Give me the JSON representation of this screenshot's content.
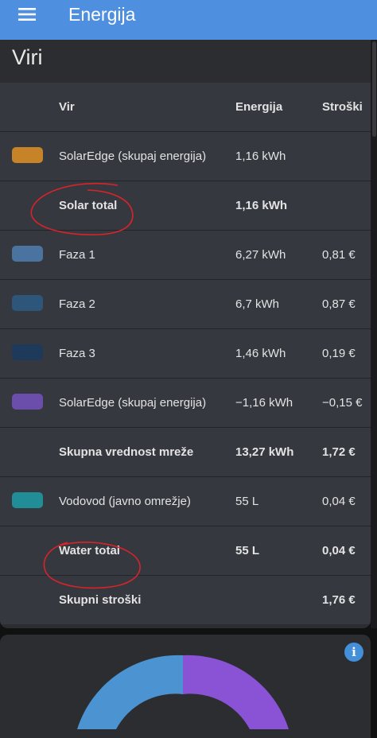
{
  "appbar": {
    "title": "Energija",
    "menu_icon": "menu-icon"
  },
  "card": {
    "title": "Viri",
    "columns": {
      "source": "Vir",
      "energy": "Energija",
      "cost": "Stroški"
    },
    "rows": [
      {
        "name": "SolarEdge (skupaj energija)",
        "energy": "1,16 kWh",
        "cost": "",
        "swatch": "#d08a2a",
        "bold": false
      },
      {
        "name": "Solar total",
        "energy": "1,16 kWh",
        "cost": "",
        "swatch": null,
        "bold": true
      },
      {
        "name": "Faza 1",
        "energy": "6,27 kWh",
        "cost": "0,81 €",
        "swatch": "#4f79a8",
        "bold": false
      },
      {
        "name": "Faza 2",
        "energy": "6,7 kWh",
        "cost": "0,87 €",
        "swatch": "#2f5a80",
        "bold": false
      },
      {
        "name": "Faza 3",
        "energy": "1,46 kWh",
        "cost": "0,19 €",
        "swatch": "#1f3d60",
        "bold": false
      },
      {
        "name": "SolarEdge (skupaj energija)",
        "energy": "−1,16 kWh",
        "cost": "−0,15 €",
        "swatch": "#7152b5",
        "bold": false
      },
      {
        "name": "Skupna vrednost mreže",
        "energy": "13,27 kWh",
        "cost": "1,72 €",
        "swatch": null,
        "bold": true
      },
      {
        "name": "Vodovod (javno omrežje)",
        "energy": "55 L",
        "cost": "0,04 €",
        "swatch": "#23949e",
        "bold": false
      },
      {
        "name": "Water total",
        "energy": "55 L",
        "cost": "0,04 €",
        "swatch": null,
        "bold": true
      },
      {
        "name": "Skupni stroški",
        "energy": "",
        "cost": "1,76 €",
        "swatch": null,
        "bold": true
      }
    ]
  },
  "chart_card": {
    "info_icon": "info-icon",
    "donut_colors": {
      "grid": "#4b93d1",
      "solar": "#8a53d6"
    }
  }
}
